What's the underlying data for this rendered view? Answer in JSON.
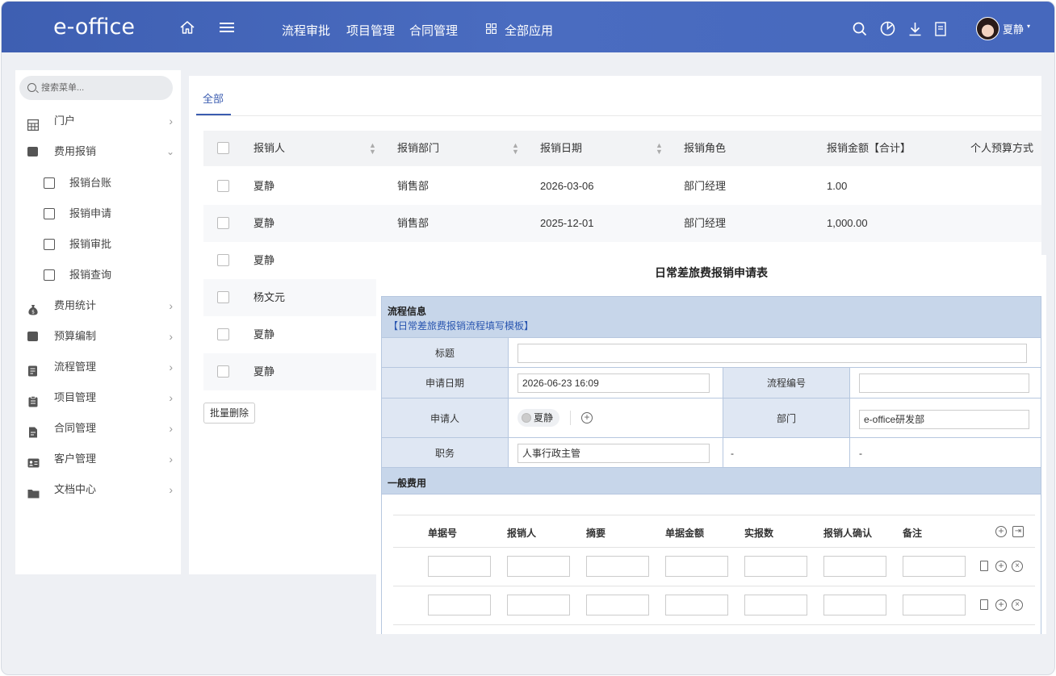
{
  "app": {
    "logo": "e-office",
    "user": "夏静"
  },
  "topnav": [
    {
      "label": "流程审批"
    },
    {
      "label": "项目管理"
    },
    {
      "label": "合同管理"
    },
    {
      "label": "全部应用"
    }
  ],
  "top_icons": [
    "home-icon",
    "menu-icon",
    "search-icon",
    "chart-icon",
    "download-icon",
    "document-icon"
  ],
  "sidebar": {
    "search_placeholder": "搜索菜单...",
    "items": [
      {
        "label": "门户",
        "icon": "grid-icon"
      },
      {
        "label": "费用报销",
        "icon": "folder-icon",
        "expanded": true
      },
      {
        "label": "报销台账",
        "icon": "box-icon"
      },
      {
        "label": "报销申请",
        "icon": "box-icon"
      },
      {
        "label": "报销审批",
        "icon": "box-icon"
      },
      {
        "label": "报销查询",
        "icon": "box-icon"
      },
      {
        "label": "费用统计",
        "icon": "money-bag-icon"
      },
      {
        "label": "预算编制",
        "icon": "folder-icon"
      },
      {
        "label": "流程管理",
        "icon": "flow-icon"
      },
      {
        "label": "项目管理",
        "icon": "clipboard-icon"
      },
      {
        "label": "合同管理",
        "icon": "contract-icon"
      },
      {
        "label": "客户管理",
        "icon": "id-card-icon"
      },
      {
        "label": "文档中心",
        "icon": "folder-icon"
      }
    ]
  },
  "tabs": [
    {
      "label": "全部"
    }
  ],
  "table": {
    "columns": [
      "报销人",
      "报销部门",
      "报销日期",
      "报销角色",
      "报销金额【合计】",
      "个人预算方式"
    ],
    "rows": [
      {
        "person": "夏静",
        "dept": "销售部",
        "date": "2026-03-06",
        "role": "部门经理",
        "amount": "1.00"
      },
      {
        "person": "夏静",
        "dept": "销售部",
        "date": "2025-12-01",
        "role": "部门经理",
        "amount": "1,000.00"
      },
      {
        "person": "夏静"
      },
      {
        "person": "杨文元"
      },
      {
        "person": "夏静"
      },
      {
        "person": "夏静"
      }
    ],
    "bulk_delete": "批量删除"
  },
  "form": {
    "title": "日常差旅费报销申请表",
    "section1": {
      "title": "流程信息",
      "link": "【日常差旅费报销流程填写模板】"
    },
    "fields": {
      "title_label": "标题",
      "date_label": "申请日期",
      "date_value": "2026-06-23 16:09",
      "flow_no_label": "流程编号",
      "applicant_label": "申请人",
      "applicant_value": "夏静",
      "dept_label": "部门",
      "dept_value": "e-office研发部",
      "position_label": "职务",
      "position_value": "人事行政主管",
      "dash1": "-",
      "dash2": "-"
    },
    "section2": {
      "title": "一般费用"
    },
    "grid_columns": [
      "单据号",
      "报销人",
      "摘要",
      "单据金额",
      "实报数",
      "报销人确认",
      "备注"
    ]
  }
}
